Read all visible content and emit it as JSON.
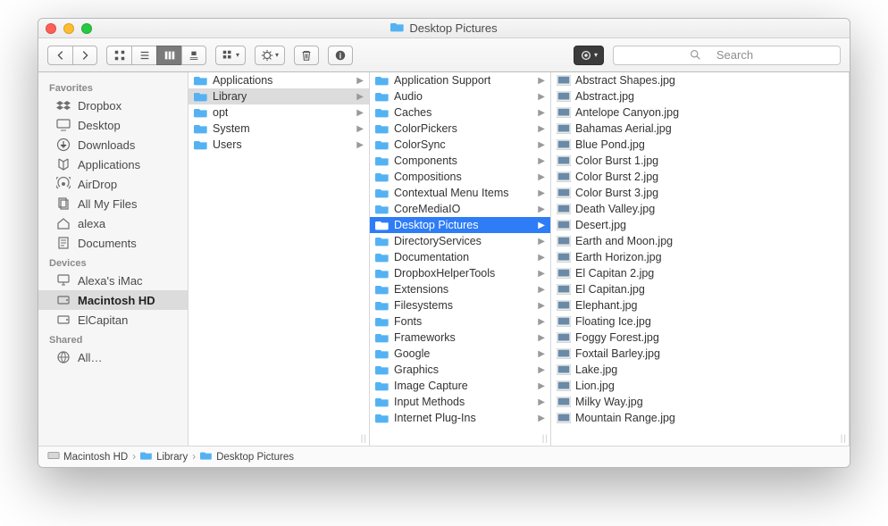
{
  "window": {
    "title": "Desktop Pictures"
  },
  "search": {
    "placeholder": "Search"
  },
  "sidebar": {
    "sections": [
      {
        "label": "Favorites",
        "items": [
          {
            "icon": "dropbox",
            "label": "Dropbox"
          },
          {
            "icon": "desktop",
            "label": "Desktop"
          },
          {
            "icon": "downloads",
            "label": "Downloads"
          },
          {
            "icon": "applications",
            "label": "Applications"
          },
          {
            "icon": "airdrop",
            "label": "AirDrop"
          },
          {
            "icon": "allfiles",
            "label": "All My Files"
          },
          {
            "icon": "home",
            "label": "alexa"
          },
          {
            "icon": "documents",
            "label": "Documents"
          }
        ]
      },
      {
        "label": "Devices",
        "items": [
          {
            "icon": "imac",
            "label": "Alexa's iMac"
          },
          {
            "icon": "hdd",
            "label": "Macintosh HD",
            "selected": true
          },
          {
            "icon": "hdd",
            "label": "ElCapitan"
          }
        ]
      },
      {
        "label": "Shared",
        "items": [
          {
            "icon": "globe",
            "label": "All…"
          }
        ]
      }
    ]
  },
  "columns": [
    {
      "items": [
        {
          "type": "folder",
          "label": "Applications",
          "has_children": true
        },
        {
          "type": "folder",
          "label": "Library",
          "has_children": true,
          "selected": "grey"
        },
        {
          "type": "folder",
          "label": "opt",
          "has_children": true
        },
        {
          "type": "folder",
          "label": "System",
          "has_children": true
        },
        {
          "type": "folder",
          "label": "Users",
          "has_children": true
        }
      ]
    },
    {
      "items": [
        {
          "type": "folder",
          "label": "Application Support",
          "has_children": true
        },
        {
          "type": "folder",
          "label": "Audio",
          "has_children": true
        },
        {
          "type": "folder",
          "label": "Caches",
          "has_children": true
        },
        {
          "type": "folder",
          "label": "ColorPickers",
          "has_children": true
        },
        {
          "type": "folder",
          "label": "ColorSync",
          "has_children": true
        },
        {
          "type": "folder",
          "label": "Components",
          "has_children": true
        },
        {
          "type": "folder",
          "label": "Compositions",
          "has_children": true
        },
        {
          "type": "folder",
          "label": "Contextual Menu Items",
          "has_children": true
        },
        {
          "type": "folder",
          "label": "CoreMediaIO",
          "has_children": true
        },
        {
          "type": "folder",
          "label": "Desktop Pictures",
          "has_children": true,
          "selected": "blue"
        },
        {
          "type": "folder",
          "label": "DirectoryServices",
          "has_children": true
        },
        {
          "type": "folder",
          "label": "Documentation",
          "has_children": true
        },
        {
          "type": "folder",
          "label": "DropboxHelperTools",
          "has_children": true
        },
        {
          "type": "folder",
          "label": "Extensions",
          "has_children": true
        },
        {
          "type": "folder",
          "label": "Filesystems",
          "has_children": true
        },
        {
          "type": "folder",
          "label": "Fonts",
          "has_children": true
        },
        {
          "type": "folder",
          "label": "Frameworks",
          "has_children": true
        },
        {
          "type": "folder",
          "label": "Google",
          "has_children": true
        },
        {
          "type": "folder",
          "label": "Graphics",
          "has_children": true
        },
        {
          "type": "folder",
          "label": "Image Capture",
          "has_children": true
        },
        {
          "type": "folder",
          "label": "Input Methods",
          "has_children": true
        },
        {
          "type": "folder",
          "label": "Internet Plug-Ins",
          "has_children": true
        }
      ]
    },
    {
      "items": [
        {
          "type": "image",
          "label": "Abstract Shapes.jpg"
        },
        {
          "type": "image",
          "label": "Abstract.jpg"
        },
        {
          "type": "image",
          "label": "Antelope Canyon.jpg"
        },
        {
          "type": "image",
          "label": "Bahamas Aerial.jpg"
        },
        {
          "type": "image",
          "label": "Blue Pond.jpg"
        },
        {
          "type": "image",
          "label": "Color Burst 1.jpg"
        },
        {
          "type": "image",
          "label": "Color Burst 2.jpg"
        },
        {
          "type": "image",
          "label": "Color Burst 3.jpg"
        },
        {
          "type": "image",
          "label": "Death Valley.jpg"
        },
        {
          "type": "image",
          "label": "Desert.jpg"
        },
        {
          "type": "image",
          "label": "Earth and Moon.jpg"
        },
        {
          "type": "image",
          "label": "Earth Horizon.jpg"
        },
        {
          "type": "image",
          "label": "El Capitan 2.jpg"
        },
        {
          "type": "image",
          "label": "El Capitan.jpg"
        },
        {
          "type": "image",
          "label": "Elephant.jpg"
        },
        {
          "type": "image",
          "label": "Floating Ice.jpg"
        },
        {
          "type": "image",
          "label": "Foggy Forest.jpg"
        },
        {
          "type": "image",
          "label": "Foxtail Barley.jpg"
        },
        {
          "type": "image",
          "label": "Lake.jpg"
        },
        {
          "type": "image",
          "label": "Lion.jpg"
        },
        {
          "type": "image",
          "label": "Milky Way.jpg"
        },
        {
          "type": "image",
          "label": "Mountain Range.jpg"
        }
      ]
    }
  ],
  "pathbar": [
    {
      "icon": "hdd",
      "label": "Macintosh HD"
    },
    {
      "icon": "folder",
      "label": "Library"
    },
    {
      "icon": "folder",
      "label": "Desktop Pictures"
    }
  ]
}
